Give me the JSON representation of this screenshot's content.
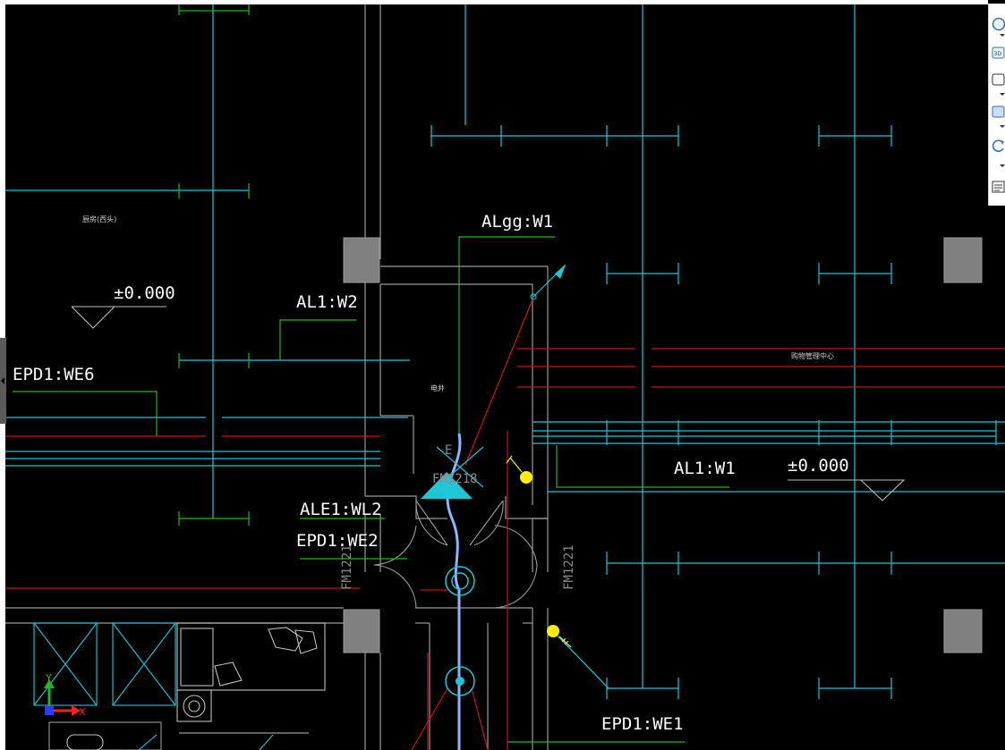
{
  "labels": {
    "algg_w1": "ALgg:W1",
    "al1_w2": "AL1:W2",
    "epd1_we6": "EPD1:WE6",
    "al1_w1": "AL1:W1",
    "ale1_wl2": "ALE1:WL2",
    "epd1_we2": "EPD1:WE2",
    "epd1_we1": "EPD1:WE1",
    "level_left": "±0.000",
    "level_right": "±0.000",
    "door_top": "FM1218",
    "door_left": "FM1221",
    "door_right": "FM1221",
    "room_kitchen": "厨房(西头)",
    "room_shaft": "电井",
    "room_center": "购物管理中心",
    "equip_label": "E"
  },
  "toolbar": {
    "buttons": [
      {
        "name": "steering-wheel-icon",
        "glyph": "◯"
      },
      {
        "name": "3d-view-icon",
        "glyph": "3D"
      },
      {
        "name": "pan-icon",
        "glyph": "▢"
      },
      {
        "name": "zoom-icon",
        "glyph": "▢"
      },
      {
        "name": "orbit-icon",
        "glyph": "↻"
      },
      {
        "name": "showmotion-icon",
        "glyph": "☰"
      }
    ]
  },
  "ucs": {
    "x_label": "X",
    "y_label": "Y"
  },
  "colors": {
    "background": "#000000",
    "cyan": "#1fc6d8",
    "green": "#22b822",
    "red": "#c8141e",
    "wall": "#9a9a9a",
    "column": "#808080",
    "yellow": "#ffee00",
    "blue_pipe": "#8fb4ff"
  }
}
